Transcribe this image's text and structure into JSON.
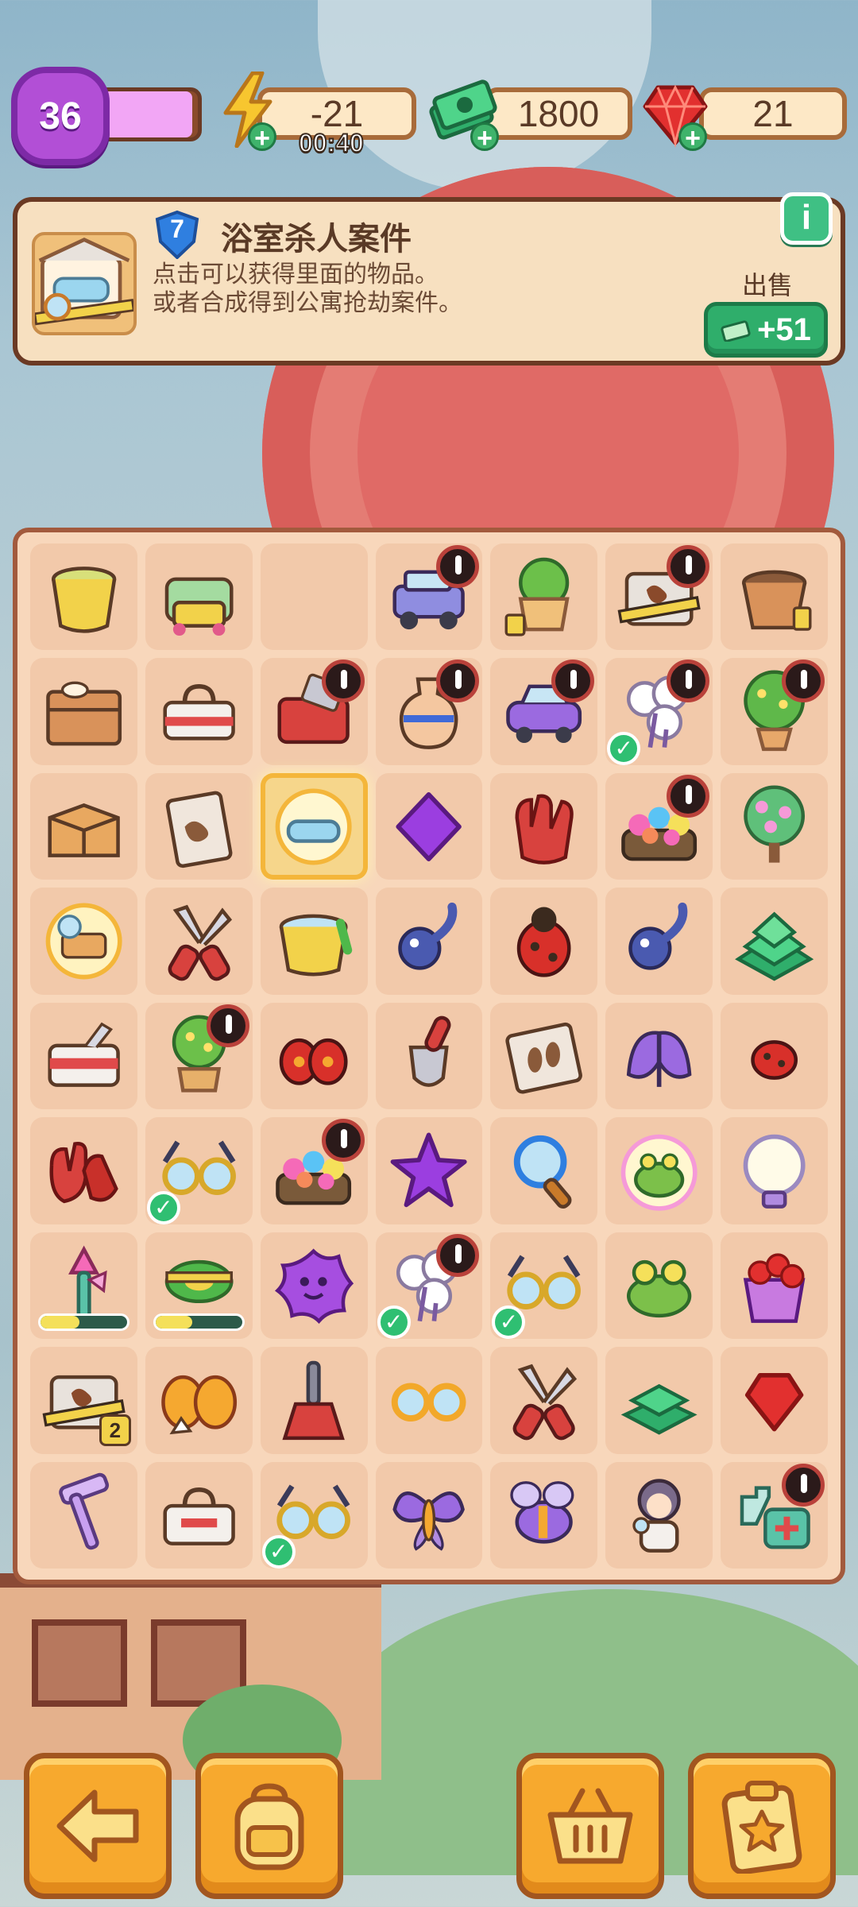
{
  "hud": {
    "level": "36",
    "level_progress": 0.95,
    "energy": "-21",
    "energy_timer": "00:40",
    "cash": "1800",
    "gems": "21"
  },
  "info_panel": {
    "item_level": "7",
    "title": "浴室杀人案件",
    "desc_line1": "点击可以获得里面的物品。",
    "desc_line2": "或者合成得到公寓抢劫案件。",
    "info_icon": "i",
    "sell_label": "出售",
    "sell_value": "+51"
  },
  "board": {
    "rows": [
      [
        {
          "icon": "bucket"
        },
        {
          "icon": "cleaning-cart"
        },
        {
          "icon": "empty"
        },
        {
          "icon": "jeep",
          "lock": true
        },
        {
          "icon": "plant-pot"
        },
        {
          "icon": "crime-scene-box",
          "lock": true
        },
        {
          "icon": "soil-pot"
        }
      ],
      [
        {
          "icon": "storage-crate"
        },
        {
          "icon": "toolbox-white"
        },
        {
          "icon": "tool-chest",
          "lock": true
        },
        {
          "icon": "vase",
          "lock": true
        },
        {
          "icon": "purple-car",
          "lock": true
        },
        {
          "icon": "cotton-flowers",
          "lock": true,
          "check": true
        },
        {
          "icon": "flower-tree",
          "lock": true
        }
      ],
      [
        {
          "icon": "cardboard-box"
        },
        {
          "icon": "evidence-bag"
        },
        {
          "icon": "bathtub-case",
          "highlight": true
        },
        {
          "icon": "purple-gem"
        },
        {
          "icon": "red-glove"
        },
        {
          "icon": "flower-garden",
          "lock": true
        },
        {
          "icon": "blossom-tree"
        }
      ],
      [
        {
          "icon": "sparkle-case"
        },
        {
          "icon": "pruning-shears"
        },
        {
          "icon": "mop-bucket"
        },
        {
          "icon": "tadpole"
        },
        {
          "icon": "ladybug"
        },
        {
          "icon": "tadpole"
        },
        {
          "icon": "cash-pile"
        }
      ],
      [
        {
          "icon": "toolbox"
        },
        {
          "icon": "bonsai",
          "lock": true
        },
        {
          "icon": "twin-bugs"
        },
        {
          "icon": "trowel"
        },
        {
          "icon": "footprint-bag"
        },
        {
          "icon": "purple-moth"
        },
        {
          "icon": "small-ladybug"
        }
      ],
      [
        {
          "icon": "red-gloves"
        },
        {
          "icon": "goggles",
          "check": true
        },
        {
          "icon": "flower-garden",
          "lock": true
        },
        {
          "icon": "purple-star"
        },
        {
          "icon": "magnifier"
        },
        {
          "icon": "glowing-frog"
        },
        {
          "icon": "light-bulb"
        }
      ],
      [
        {
          "icon": "feather-duster",
          "progress": 0.45
        },
        {
          "icon": "tape-roll",
          "progress": 0.42
        },
        {
          "icon": "purple-blob"
        },
        {
          "icon": "cotton-flowers",
          "lock": true,
          "check": true
        },
        {
          "icon": "goggles",
          "check": true
        },
        {
          "icon": "frog"
        },
        {
          "icon": "gem-bucket"
        }
      ],
      [
        {
          "icon": "crime-scene-box",
          "badge": "2"
        },
        {
          "icon": "butterfly-bugs"
        },
        {
          "icon": "broom"
        },
        {
          "icon": "yellow-glasses"
        },
        {
          "icon": "pruning-shears"
        },
        {
          "icon": "cash-stack"
        },
        {
          "icon": "red-gem"
        }
      ],
      [
        {
          "icon": "hammer"
        },
        {
          "icon": "white-toolbox"
        },
        {
          "icon": "goggles",
          "check": true
        },
        {
          "icon": "butterfly"
        },
        {
          "icon": "purple-bee"
        },
        {
          "icon": "detective-girl"
        },
        {
          "icon": "first-aid-kit",
          "lock": true
        }
      ]
    ]
  },
  "bottom_buttons": [
    {
      "name": "back-button",
      "icon": "arrow-left-icon"
    },
    {
      "name": "backpack-button",
      "icon": "backpack-icon"
    },
    {
      "name": "shop-basket-button",
      "icon": "basket-icon"
    },
    {
      "name": "tasks-button",
      "icon": "clipboard-star-icon"
    }
  ],
  "colors": {
    "board_bg": "#f8d7bb",
    "cell_bg": "#f2c9aa",
    "accent_green": "#2fae6b",
    "level_purple": "#b24fd6",
    "button_orange": "#f7a92e"
  }
}
